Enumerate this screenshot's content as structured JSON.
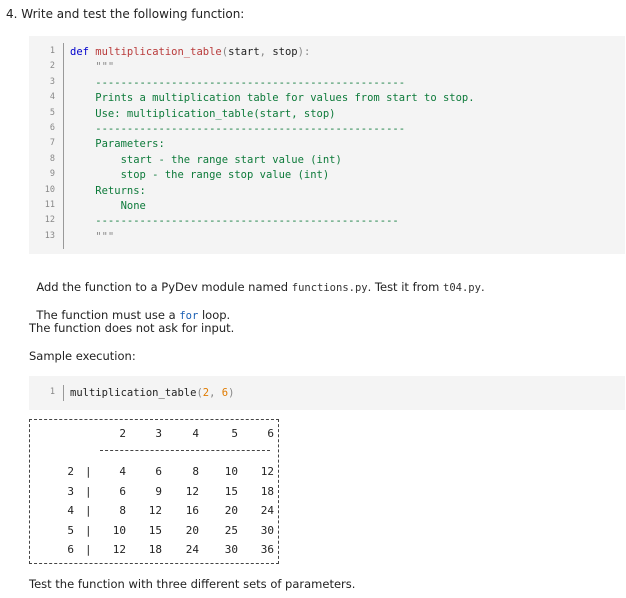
{
  "heading": "4. Write and test the following function:",
  "code_main": {
    "lines": [
      {
        "n": "1",
        "parts": [
          {
            "t": "def ",
            "c": "kw"
          },
          {
            "t": "multiplication_table",
            "c": "fn"
          },
          {
            "t": "(",
            "c": "pun"
          },
          {
            "t": "start",
            "c": ""
          },
          {
            "t": ", ",
            "c": "pun"
          },
          {
            "t": "stop",
            "c": ""
          },
          {
            "t": "):",
            "c": "pun"
          }
        ]
      },
      {
        "n": "2",
        "parts": [
          {
            "t": "    \"\"\"",
            "c": "str"
          }
        ]
      },
      {
        "n": "3",
        "parts": [
          {
            "t": "    -------------------------------------------------",
            "c": "doc"
          }
        ]
      },
      {
        "n": "4",
        "parts": [
          {
            "t": "    Prints a multiplication table for values from start to stop.",
            "c": "doc"
          }
        ]
      },
      {
        "n": "5",
        "parts": [
          {
            "t": "    Use: multiplication_table(start, stop)",
            "c": "doc"
          }
        ]
      },
      {
        "n": "6",
        "parts": [
          {
            "t": "    -------------------------------------------------",
            "c": "doc"
          }
        ]
      },
      {
        "n": "7",
        "parts": [
          {
            "t": "    Parameters:",
            "c": "doc"
          }
        ]
      },
      {
        "n": "8",
        "parts": [
          {
            "t": "        start - the range start value (int)",
            "c": "doc"
          }
        ]
      },
      {
        "n": "9",
        "parts": [
          {
            "t": "        stop - the range stop value (int)",
            "c": "doc"
          }
        ]
      },
      {
        "n": "10",
        "parts": [
          {
            "t": "    Returns:",
            "c": "doc"
          }
        ]
      },
      {
        "n": "11",
        "parts": [
          {
            "t": "        None",
            "c": "doc"
          }
        ]
      },
      {
        "n": "12",
        "parts": [
          {
            "t": "    ------------------------------------------------",
            "c": "doc"
          }
        ]
      },
      {
        "n": "13",
        "parts": [
          {
            "t": "    \"\"\"",
            "c": "str"
          }
        ]
      }
    ]
  },
  "para1": {
    "before": "Add the function to a PyDev module named ",
    "code1": "functions.py",
    "middle": ". Test it from ",
    "code2": "t04.py",
    "after": "."
  },
  "para2": {
    "before": "The function must use a ",
    "code": "for",
    "after": " loop."
  },
  "para3": "The function does not ask for input.",
  "para4": "Sample execution:",
  "code_sample": {
    "line_number": "1",
    "parts": [
      {
        "t": "multiplication_table",
        "c": ""
      },
      {
        "t": "(",
        "c": "pun"
      },
      {
        "t": "2",
        "c": "num"
      },
      {
        "t": ", ",
        "c": "pun"
      },
      {
        "t": "6",
        "c": "num"
      },
      {
        "t": ")",
        "c": "pun"
      }
    ]
  },
  "output_table": {
    "headers": [
      "2",
      "3",
      "4",
      "5",
      "6"
    ],
    "rows": [
      {
        "label": "2",
        "values": [
          "4",
          "6",
          "8",
          "10",
          "12"
        ]
      },
      {
        "label": "3",
        "values": [
          "6",
          "9",
          "12",
          "15",
          "18"
        ]
      },
      {
        "label": "4",
        "values": [
          "8",
          "12",
          "16",
          "20",
          "24"
        ]
      },
      {
        "label": "5",
        "values": [
          "10",
          "15",
          "20",
          "25",
          "30"
        ]
      },
      {
        "label": "6",
        "values": [
          "12",
          "18",
          "24",
          "30",
          "36"
        ]
      }
    ],
    "separator": "|"
  },
  "para5": "Test the function with three different sets of parameters."
}
